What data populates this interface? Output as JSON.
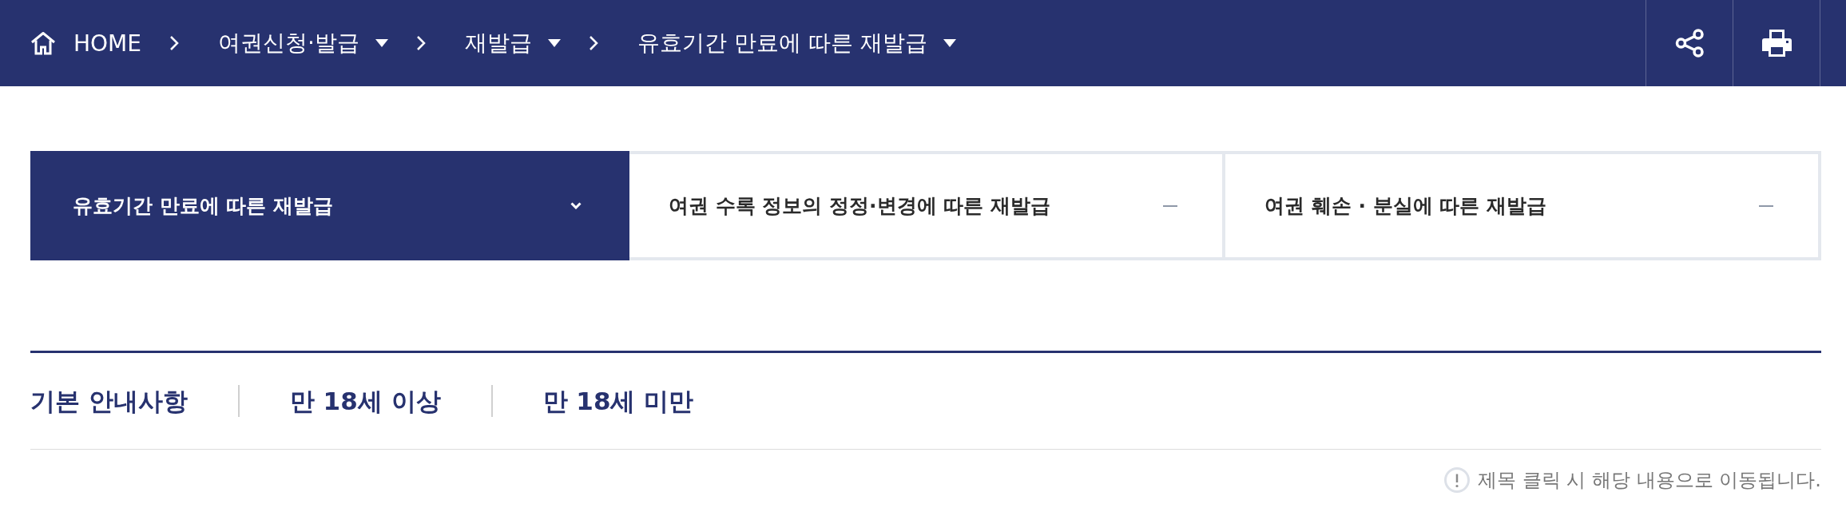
{
  "breadcrumb": {
    "home": "HOME",
    "items": [
      {
        "label": "여권신청·발급"
      },
      {
        "label": "재발급"
      },
      {
        "label": "유효기간 만료에 따른 재발급"
      }
    ]
  },
  "tabs": [
    {
      "label": "유효기간 만료에 따른 재발급",
      "selected": true
    },
    {
      "label": "여권 수록 정보의 정정·변경에 따른 재발급",
      "selected": false
    },
    {
      "label": "여권 훼손 · 분실에 따른 재발급",
      "selected": false
    }
  ],
  "section_links": [
    {
      "label": "기본 안내사항"
    },
    {
      "label": "만 18세 이상"
    },
    {
      "label": "만 18세 미만"
    }
  ],
  "notice": "제목 클릭 시 해당 내용으로 이동됩니다."
}
